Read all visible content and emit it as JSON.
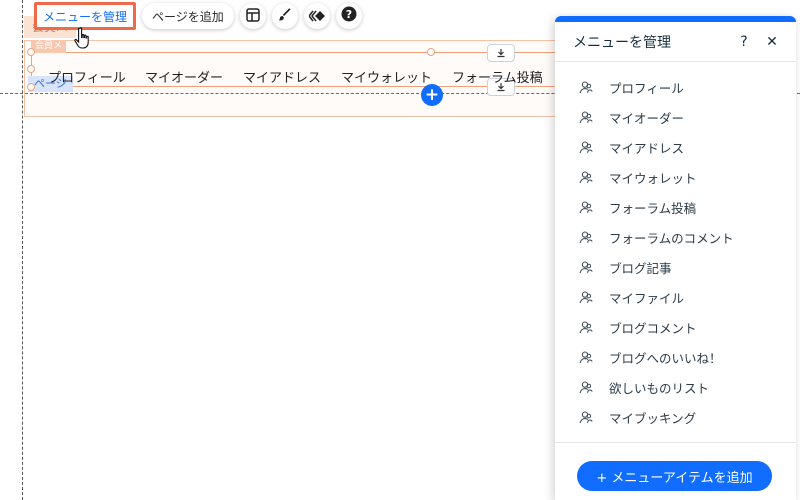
{
  "toolbar": {
    "manage_menu_label": "メニューを管理",
    "add_page_label": "ページを追加"
  },
  "canvas": {
    "section_tag": "会員バ",
    "element_tag": "会員メ",
    "page_tag": "ページ",
    "nav_items": [
      "プロフィール",
      "マイオーダー",
      "マイアドレス",
      "マイウォレット",
      "フォーラム投稿"
    ],
    "add_label": "+"
  },
  "panel": {
    "title": "メニューを管理",
    "help_label": "?",
    "close_label": "✕",
    "items": [
      "プロフィール",
      "マイオーダー",
      "マイアドレス",
      "マイウォレット",
      "フォーラム投稿",
      "フォーラムのコメント",
      "ブログ記事",
      "マイファイル",
      "ブログコメント",
      "ブログへのいいね！",
      "欲しいものリスト",
      "マイブッキング"
    ],
    "add_item_label": "+ メニューアイテムを追加"
  },
  "colors": {
    "accent": "#116dff",
    "highlight": "#ee6a4a"
  }
}
